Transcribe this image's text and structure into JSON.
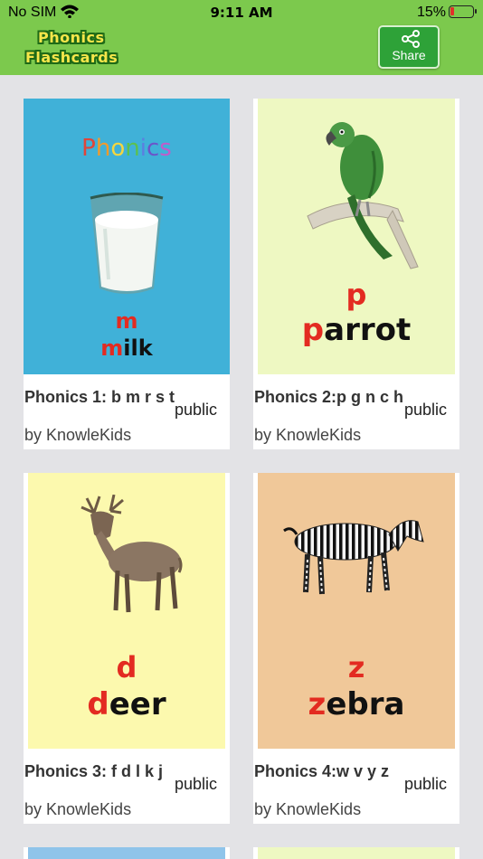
{
  "status_bar": {
    "carrier": "No SIM",
    "time": "9:11 AM",
    "battery": "15%"
  },
  "header": {
    "logo_line1": "Phonics",
    "logo_line2": "Flashcards",
    "share_label": "Share"
  },
  "cards": [
    {
      "title": "Phonics 1: b m r s t",
      "badge": "public",
      "author": "by KnowleKids",
      "art_heading": "Phonics",
      "letter": "m",
      "word_first": "m",
      "word_rest": "ilk",
      "picture": "milk-glass"
    },
    {
      "title": "Phonics 2:p g n c h",
      "badge": "public",
      "author": "by KnowleKids",
      "letter": "p",
      "word_first": "p",
      "word_rest": "arrot",
      "picture": "parrot"
    },
    {
      "title": "Phonics 3: f d l k j",
      "badge": "public",
      "author": "by KnowleKids",
      "letter": "d",
      "word_first": "d",
      "word_rest": "eer",
      "picture": "deer"
    },
    {
      "title": "Phonics 4:w v y z",
      "badge": "public",
      "author": "by KnowleKids",
      "letter": "z",
      "word_first": "z",
      "word_rest": "ebra",
      "picture": "zebra"
    }
  ],
  "colors": {
    "header_bg": "#7cc94d",
    "share_bg": "#2ea238",
    "accent_red": "#e32b21",
    "card1_bg": "#40b1d8",
    "card2_bg": "#eef8c2",
    "card3_bg": "#fcf9ae",
    "card4_bg": "#f0c899",
    "page_bg": "#e3e3e6"
  }
}
